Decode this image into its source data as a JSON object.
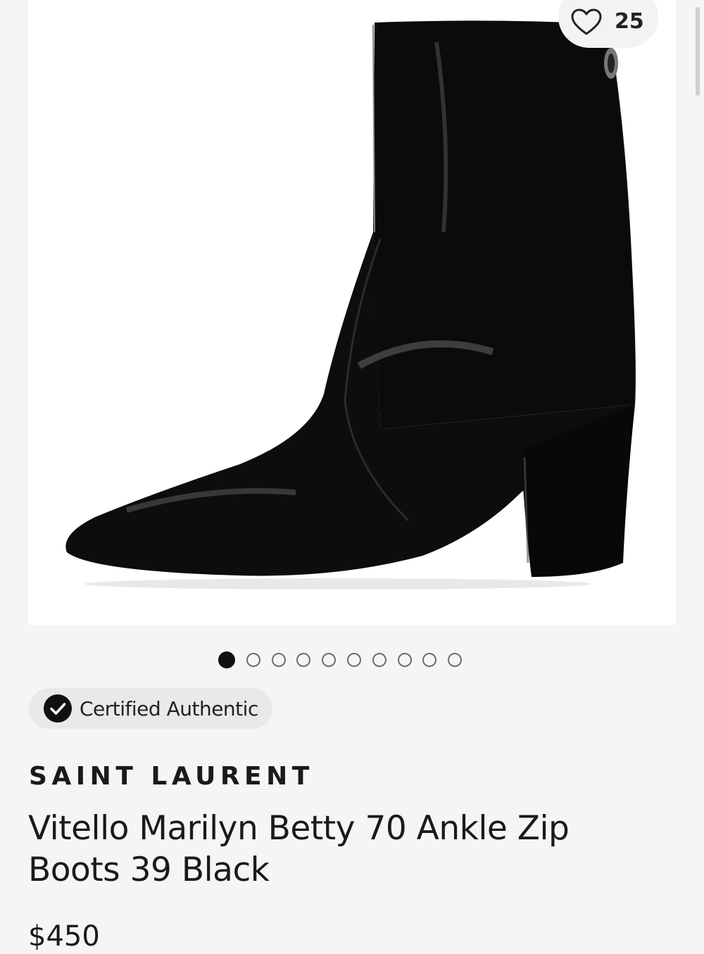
{
  "product": {
    "like_count": "25",
    "brand": "SAINT LAURENT",
    "title": "Vitello Marilyn Betty 70 Ankle Zip Boots 39 Black",
    "price": "$450",
    "badge": "Certified Authentic"
  },
  "gallery": {
    "total_images": 10,
    "current_index": 1
  },
  "icons": {
    "like": "heart-outline-icon",
    "badge": "check-circle-icon"
  },
  "colors": {
    "background": "#f6f5f4",
    "badge_background": "#ebe9e7",
    "active_dot": "#111111",
    "text": "#1a1a1a"
  }
}
